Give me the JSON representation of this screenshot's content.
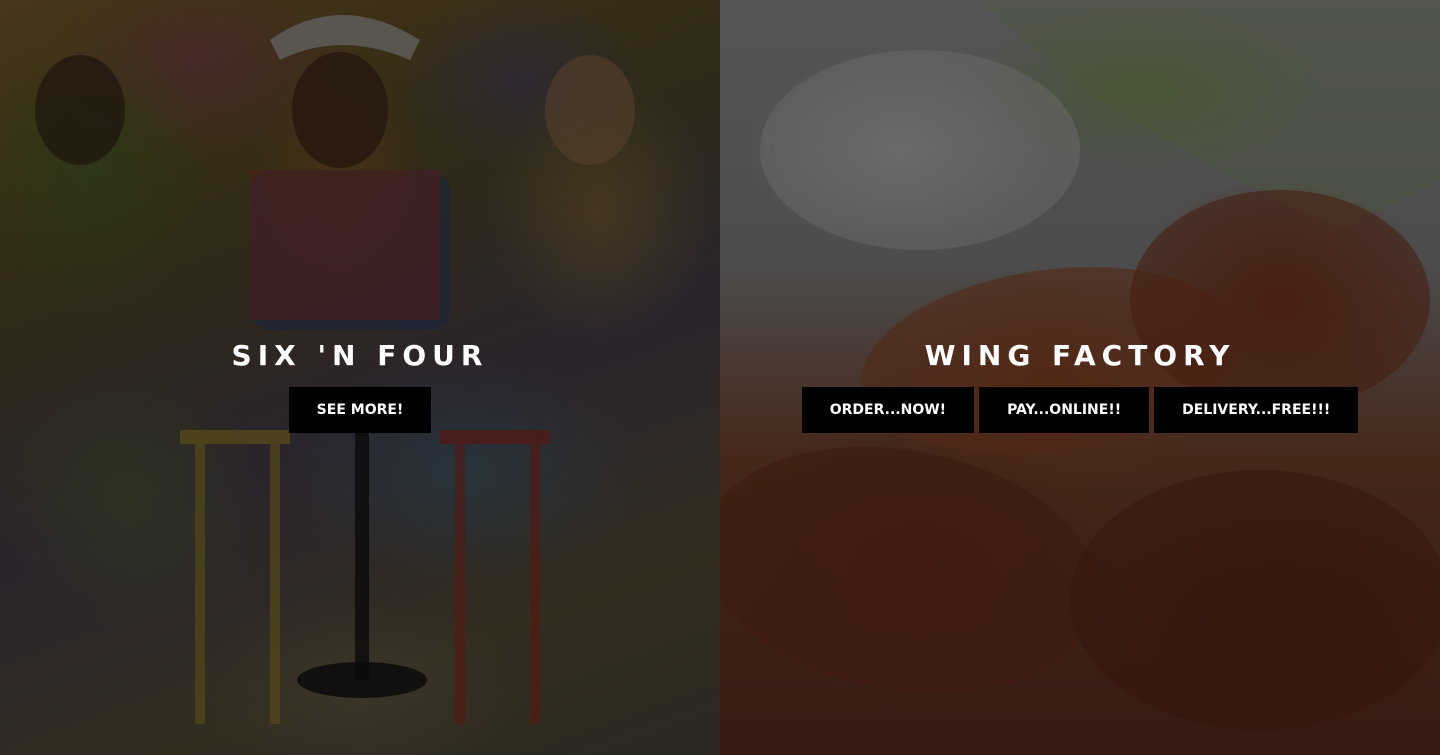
{
  "left_panel": {
    "title": "SIX 'N FOUR",
    "buttons": [
      {
        "label": "SEE MORE!"
      }
    ]
  },
  "right_panel": {
    "title": "WING FACTORY",
    "buttons": [
      {
        "label": "ORDER...NOW!"
      },
      {
        "label": "PAY...ONLINE!!"
      },
      {
        "label": "DELIVERY...FREE!!!"
      }
    ]
  },
  "colors": {
    "button_bg": "#000000",
    "text": "#ffffff"
  }
}
